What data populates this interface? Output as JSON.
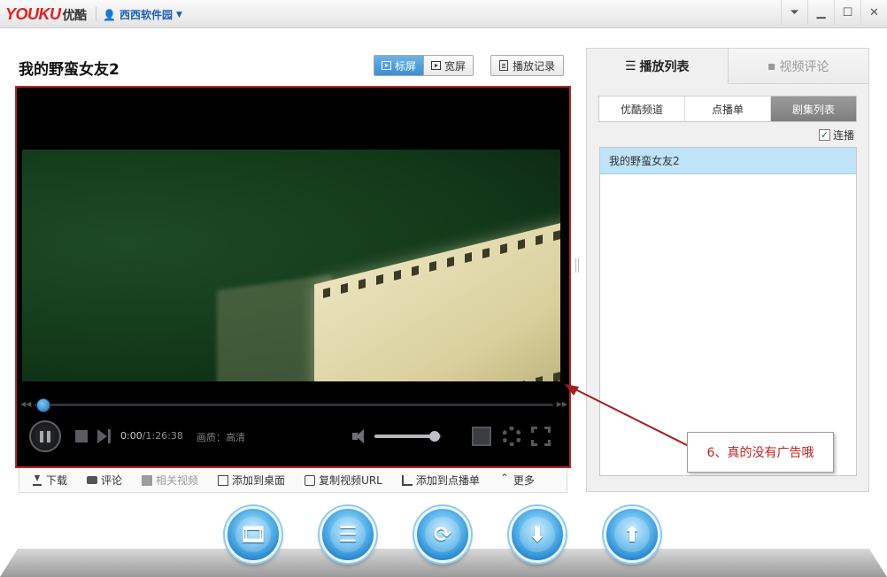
{
  "titlebar": {
    "logo_latin": "YOUKU",
    "logo_cn": "优酷",
    "user_name": "西西软件园",
    "controls": [
      "filter-icon",
      "minimize-icon",
      "maximize-icon",
      "close-icon"
    ]
  },
  "video": {
    "title": "我的野蛮女友2",
    "view_modes": [
      {
        "label": "标屏",
        "active": true
      },
      {
        "label": "宽屏",
        "active": false
      }
    ],
    "history_label": "播放记录"
  },
  "player": {
    "current_time": "0:00",
    "total_time": "1:26:38",
    "quality_label": "画质：高清",
    "progress_fraction": 0.0,
    "volume_fraction": 0.9
  },
  "actions": [
    {
      "label": "下载",
      "icon": "download-icon",
      "enabled": true
    },
    {
      "label": "评论",
      "icon": "comment-icon",
      "enabled": true
    },
    {
      "label": "相关视频",
      "icon": "related-video-icon",
      "enabled": false
    },
    {
      "label": "添加到桌面",
      "icon": "desktop-shortcut-icon",
      "enabled": true
    },
    {
      "label": "复制视频URL",
      "icon": "copy-url-icon",
      "enabled": true
    },
    {
      "label": "添加到点播单",
      "icon": "add-to-playlist-icon",
      "enabled": true
    },
    {
      "label": "更多",
      "icon": "more-icon",
      "enabled": true
    }
  ],
  "sidebar": {
    "tabs": [
      {
        "label": "播放列表",
        "icon": "list-icon",
        "active": true
      },
      {
        "label": "视频评论",
        "icon": "comment-icon",
        "active": false
      }
    ],
    "segments": [
      {
        "label": "优酷频道",
        "active": false
      },
      {
        "label": "点播单",
        "active": false
      },
      {
        "label": "剧集列表",
        "active": true
      }
    ],
    "autoplay_label": "连播",
    "autoplay_checked": true,
    "playlist": [
      "我的野蛮女友2"
    ]
  },
  "annotation": {
    "text": "6、真的没有广告哦",
    "color": "#c0221f"
  },
  "dock": [
    {
      "name": "film-library-icon"
    },
    {
      "name": "playlist-icon"
    },
    {
      "name": "refresh-icon"
    },
    {
      "name": "download-manager-icon"
    },
    {
      "name": "upload-icon"
    }
  ],
  "colors": {
    "accent": "#3d8fd1",
    "player_border": "#b02a2a",
    "selected_row": "#bfe3f8"
  }
}
